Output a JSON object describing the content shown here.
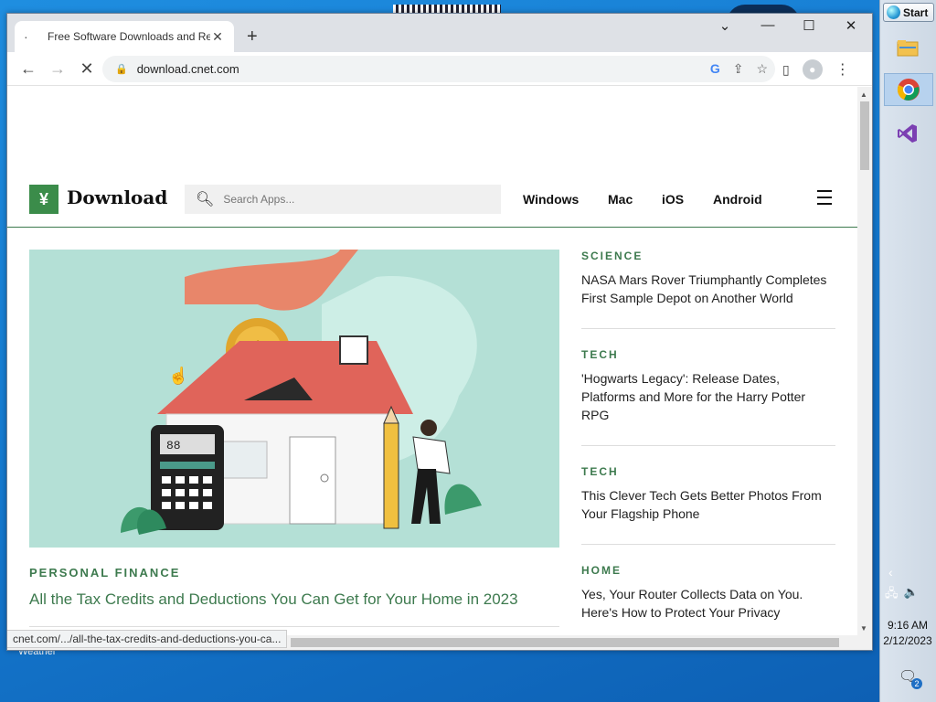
{
  "desktop": {
    "label": "Weather"
  },
  "taskbar": {
    "start_label": "Start",
    "apps": [
      {
        "icon": "file-explorer-icon"
      },
      {
        "icon": "chrome-icon",
        "active": true
      },
      {
        "icon": "visual-studio-icon"
      }
    ],
    "clock_time": "9:16 AM",
    "clock_date": "2/12/2023",
    "notification_count": "2"
  },
  "browser": {
    "tab_title": "Free Software Downloads and Re",
    "url": "download.cnet.com",
    "status_url": "cnet.com/.../all-the-tax-credits-and-deductions-you-ca..."
  },
  "site": {
    "logo_text": "Download",
    "search_placeholder": "Search Apps...",
    "nav": [
      "Windows",
      "Mac",
      "iOS",
      "Android"
    ],
    "hero": {
      "category": "PERSONAL FINANCE",
      "title": "All the Tax Credits and Deductions You Can Get for Your Home in 2023",
      "calculator_display": "88",
      "coin_symbol": "$"
    },
    "side_articles": [
      {
        "category": "SCIENCE",
        "title": "NASA Mars Rover Triumphantly Completes First Sample Depot on Another World"
      },
      {
        "category": "TECH",
        "title": "'Hogwarts Legacy': Release Dates, Platforms and More for the Harry Potter RPG"
      },
      {
        "category": "TECH",
        "title": "This Clever Tech Gets Better Photos From Your Flagship Phone"
      },
      {
        "category": "HOME",
        "title": "Yes, Your Router Collects Data on You. Here's How to Protect Your Privacy"
      }
    ]
  },
  "colors": {
    "brand_green": "#3b8c4a",
    "text_green": "#3d7a4e",
    "hero_bg": "#b4e0d6"
  }
}
